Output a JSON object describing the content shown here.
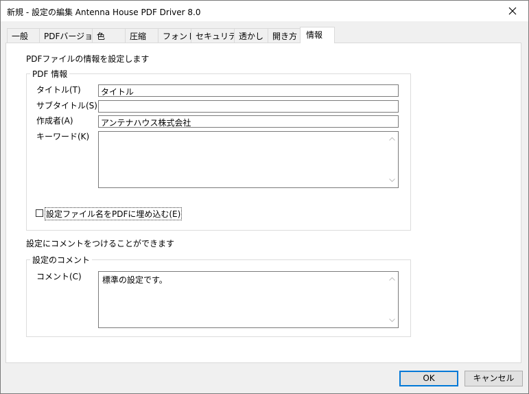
{
  "window": {
    "title": "新規 - 設定の編集 Antenna House PDF Driver 8.0"
  },
  "tabs": [
    {
      "label": "一般"
    },
    {
      "label": "PDFバージョン"
    },
    {
      "label": "色"
    },
    {
      "label": "圧縮"
    },
    {
      "label": "フォント"
    },
    {
      "label": "セキュリティ"
    },
    {
      "label": "透かし"
    },
    {
      "label": "開き方"
    },
    {
      "label": "情報",
      "active": true
    }
  ],
  "info": {
    "intro": "PDFファイルの情報を設定します",
    "group_label": "PDF 情報",
    "title_label": "タイトル(T)",
    "title_value": "タイトル",
    "subtitle_label": "サブタイトル(S)",
    "subtitle_value": "",
    "author_label": "作成者(A)",
    "author_value": "アンテナハウス株式会社",
    "keywords_label": "キーワード(K)",
    "keywords_value": "",
    "embed_label": "設定ファイル名をPDFに埋め込む(E)",
    "embed_checked": false
  },
  "comment": {
    "intro": "設定にコメントをつけることができます",
    "group_label": "設定のコメント",
    "label": "コメント(C)",
    "value": "標準の設定です。"
  },
  "buttons": {
    "ok": "OK",
    "cancel": "キャンセル"
  },
  "colors": {
    "accent": "#0078d7",
    "border": "#7a7a7a"
  }
}
